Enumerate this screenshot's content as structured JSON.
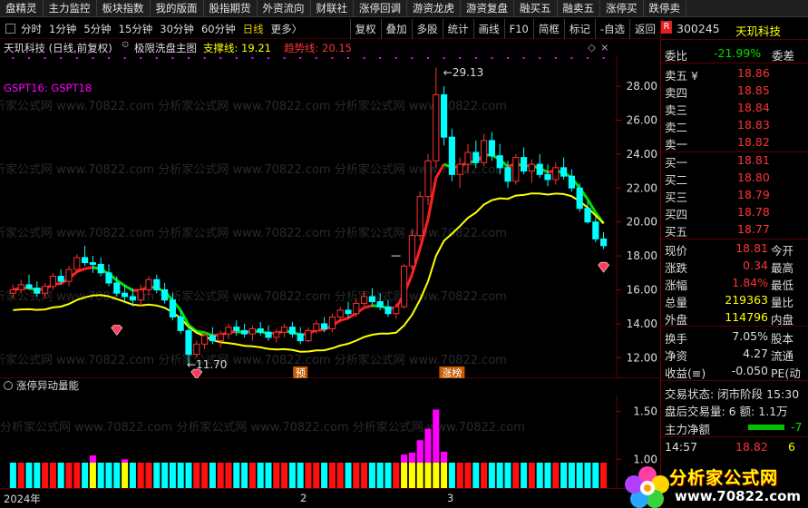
{
  "top_menu": [
    "盘精灵",
    "主力监控",
    "板块指数",
    "我的版面",
    "股指期货",
    "外资流向",
    "财联社",
    "涨停回调",
    "游资龙虎",
    "游资复盘",
    "融买五",
    "融卖五",
    "涨停买",
    "跌停卖"
  ],
  "toolbar": {
    "periods": [
      "分时",
      "1分钟",
      "5分钟",
      "15分钟",
      "30分钟",
      "60分钟",
      "日线",
      "更多〉"
    ],
    "active_period": "日线",
    "right_buttons": [
      "复权",
      "叠加",
      "多股",
      "统计",
      "画线",
      "F10",
      "简框",
      "标记",
      "-自选",
      "返回"
    ]
  },
  "chart_title": {
    "stock": "天玑科技 (日线,前复权)",
    "indicator": "极限洗盘主图",
    "support_label": "支撑线: 19.21",
    "trend_label": "趋势线: 20.15",
    "legend": "GSPT16: GSPT18"
  },
  "annotations": {
    "high": "29.13",
    "low": "11.70",
    "tag1": "预",
    "tag2": "涨榜"
  },
  "indicator_panel": {
    "title": "涨停异动量能",
    "axis": [
      "1.50",
      "1.00"
    ]
  },
  "time_axis": [
    "2024年",
    "2",
    "3"
  ],
  "watermark": "分析家公式网 www.70822.com",
  "colors": {
    "up": "#ff3232",
    "down": "#00ffff",
    "yellow": "#ffff00",
    "green": "#00e000",
    "magenta": "#ff00ff",
    "blue_bar": "#00ffff"
  },
  "chart_data": {
    "type": "candlestick",
    "y_ticks": [
      "28.00",
      "26.00",
      "24.00",
      "22.00",
      "20.00",
      "18.00",
      "16.00",
      "14.00",
      "12.00"
    ],
    "ylim": [
      11.0,
      29.5
    ],
    "candles": [
      [
        15.8,
        16.3,
        15.5,
        16.0
      ],
      [
        16.0,
        16.6,
        15.8,
        16.3
      ],
      [
        16.3,
        16.9,
        16.0,
        16.1
      ],
      [
        16.1,
        16.5,
        15.6,
        15.8
      ],
      [
        15.8,
        16.4,
        15.5,
        16.2
      ],
      [
        16.2,
        17.0,
        16.0,
        16.8
      ],
      [
        16.8,
        17.2,
        16.3,
        16.5
      ],
      [
        16.5,
        17.4,
        16.2,
        17.2
      ],
      [
        17.2,
        18.1,
        17.0,
        17.9
      ],
      [
        17.9,
        18.6,
        17.4,
        17.6
      ],
      [
        17.6,
        18.0,
        17.0,
        17.5
      ],
      [
        17.5,
        17.9,
        16.8,
        17.0
      ],
      [
        17.0,
        17.5,
        16.2,
        16.4
      ],
      [
        16.4,
        16.8,
        15.6,
        15.8
      ],
      [
        15.8,
        16.3,
        15.3,
        15.6
      ],
      [
        15.6,
        16.1,
        15.0,
        15.4
      ],
      [
        15.4,
        16.3,
        15.0,
        16.0
      ],
      [
        16.0,
        16.8,
        15.7,
        16.6
      ],
      [
        16.6,
        16.9,
        15.8,
        16.0
      ],
      [
        16.0,
        16.4,
        15.2,
        15.4
      ],
      [
        15.4,
        15.8,
        14.2,
        14.4
      ],
      [
        14.4,
        14.8,
        13.4,
        13.6
      ],
      [
        13.6,
        13.9,
        11.7,
        12.2
      ],
      [
        12.2,
        13.0,
        12.0,
        12.8
      ],
      [
        12.8,
        13.6,
        12.5,
        13.3
      ],
      [
        13.3,
        13.8,
        12.8,
        13.0
      ],
      [
        13.0,
        13.6,
        12.6,
        13.4
      ],
      [
        13.4,
        14.0,
        13.1,
        13.8
      ],
      [
        13.8,
        14.2,
        13.3,
        13.6
      ],
      [
        13.6,
        14.0,
        13.2,
        13.4
      ],
      [
        13.4,
        13.9,
        13.0,
        13.7
      ],
      [
        13.7,
        14.1,
        13.3,
        13.5
      ],
      [
        13.5,
        13.9,
        13.0,
        13.2
      ],
      [
        13.2,
        13.7,
        12.9,
        13.5
      ],
      [
        13.5,
        14.0,
        13.2,
        13.8
      ],
      [
        13.8,
        14.1,
        13.2,
        13.4
      ],
      [
        13.4,
        13.8,
        12.8,
        13.0
      ],
      [
        13.0,
        13.8,
        12.9,
        13.6
      ],
      [
        13.6,
        14.2,
        13.4,
        14.0
      ],
      [
        14.0,
        14.4,
        13.5,
        13.7
      ],
      [
        13.7,
        14.6,
        13.5,
        14.4
      ],
      [
        14.4,
        15.0,
        14.1,
        14.8
      ],
      [
        14.8,
        15.3,
        14.3,
        14.6
      ],
      [
        14.6,
        15.5,
        14.4,
        15.2
      ],
      [
        15.2,
        15.9,
        15.0,
        15.6
      ],
      [
        15.6,
        16.1,
        15.0,
        15.3
      ],
      [
        15.3,
        15.8,
        14.8,
        15.0
      ],
      [
        15.0,
        15.4,
        14.4,
        14.6
      ],
      [
        14.6,
        15.2,
        14.3,
        15.0
      ],
      [
        15.0,
        17.5,
        14.9,
        17.4
      ],
      [
        17.4,
        19.6,
        17.2,
        19.2
      ],
      [
        19.2,
        21.8,
        18.9,
        21.5
      ],
      [
        21.5,
        24.0,
        21.0,
        23.6
      ],
      [
        23.6,
        29.1,
        23.2,
        27.5
      ],
      [
        27.5,
        28.0,
        24.5,
        25.0
      ],
      [
        25.0,
        25.5,
        22.4,
        22.8
      ],
      [
        22.8,
        23.8,
        22.0,
        23.4
      ],
      [
        23.4,
        24.6,
        22.9,
        24.1
      ],
      [
        24.1,
        24.8,
        23.2,
        23.5
      ],
      [
        23.5,
        25.2,
        23.3,
        24.8
      ],
      [
        24.8,
        25.3,
        23.6,
        23.9
      ],
      [
        23.9,
        24.6,
        22.8,
        23.2
      ],
      [
        23.2,
        23.6,
        22.0,
        22.4
      ],
      [
        22.4,
        24.0,
        22.2,
        23.8
      ],
      [
        23.8,
        24.4,
        22.8,
        23.0
      ],
      [
        23.0,
        23.7,
        22.3,
        23.4
      ],
      [
        23.4,
        24.0,
        22.6,
        22.8
      ],
      [
        22.8,
        23.4,
        22.1,
        22.5
      ],
      [
        22.5,
        23.5,
        22.2,
        23.2
      ],
      [
        23.2,
        23.8,
        22.5,
        22.7
      ],
      [
        22.7,
        23.1,
        21.8,
        22.0
      ],
      [
        22.0,
        22.3,
        20.6,
        20.8
      ],
      [
        20.8,
        21.2,
        19.9,
        20.0
      ],
      [
        20.0,
        20.3,
        18.8,
        19.0
      ],
      [
        19.0,
        19.4,
        18.4,
        18.6
      ]
    ],
    "indicator_bars": [
      {
        "v": 0.7,
        "c": "cyan"
      },
      {
        "v": 0.7,
        "c": "red"
      },
      {
        "v": 0.7,
        "c": "cyan"
      },
      {
        "v": 0.7,
        "c": "cyan"
      },
      {
        "v": 0.7,
        "c": "red"
      },
      {
        "v": 0.7,
        "c": "red"
      },
      {
        "v": 0.7,
        "c": "cyan"
      },
      {
        "v": 0.7,
        "c": "red"
      },
      {
        "v": 0.7,
        "c": "red"
      },
      {
        "v": 0.7,
        "c": "cyan"
      },
      {
        "v": 1.04,
        "c": "magenta"
      },
      {
        "v": 0.7,
        "c": "cyan"
      },
      {
        "v": 0.7,
        "c": "cyan"
      },
      {
        "v": 0.7,
        "c": "cyan"
      },
      {
        "v": 1.0,
        "c": "magenta"
      },
      {
        "v": 0.7,
        "c": "cyan"
      },
      {
        "v": 0.7,
        "c": "red"
      },
      {
        "v": 0.7,
        "c": "red"
      },
      {
        "v": 0.7,
        "c": "cyan"
      },
      {
        "v": 0.7,
        "c": "cyan"
      },
      {
        "v": 0.7,
        "c": "cyan"
      },
      {
        "v": 0.7,
        "c": "cyan"
      },
      {
        "v": 0.7,
        "c": "cyan"
      },
      {
        "v": 0.7,
        "c": "red"
      },
      {
        "v": 0.7,
        "c": "red"
      },
      {
        "v": 0.7,
        "c": "cyan"
      },
      {
        "v": 0.7,
        "c": "red"
      },
      {
        "v": 0.7,
        "c": "red"
      },
      {
        "v": 0.7,
        "c": "cyan"
      },
      {
        "v": 0.7,
        "c": "cyan"
      },
      {
        "v": 0.7,
        "c": "red"
      },
      {
        "v": 0.7,
        "c": "cyan"
      },
      {
        "v": 0.7,
        "c": "cyan"
      },
      {
        "v": 0.7,
        "c": "red"
      },
      {
        "v": 0.7,
        "c": "red"
      },
      {
        "v": 0.7,
        "c": "cyan"
      },
      {
        "v": 0.7,
        "c": "cyan"
      },
      {
        "v": 0.7,
        "c": "red"
      },
      {
        "v": 0.7,
        "c": "red"
      },
      {
        "v": 0.7,
        "c": "cyan"
      },
      {
        "v": 0.7,
        "c": "red"
      },
      {
        "v": 0.7,
        "c": "red"
      },
      {
        "v": 0.7,
        "c": "cyan"
      },
      {
        "v": 0.7,
        "c": "red"
      },
      {
        "v": 0.7,
        "c": "red"
      },
      {
        "v": 0.7,
        "c": "cyan"
      },
      {
        "v": 0.7,
        "c": "cyan"
      },
      {
        "v": 0.7,
        "c": "cyan"
      },
      {
        "v": 0.7,
        "c": "red"
      },
      {
        "v": 1.05,
        "c": "magenta"
      },
      {
        "v": 1.07,
        "c": "magenta"
      },
      {
        "v": 1.2,
        "c": "magenta"
      },
      {
        "v": 1.32,
        "c": "magenta"
      },
      {
        "v": 1.52,
        "c": "magenta"
      },
      {
        "v": 1.08,
        "c": "magenta"
      },
      {
        "v": 0.7,
        "c": "cyan"
      },
      {
        "v": 0.7,
        "c": "red"
      },
      {
        "v": 0.7,
        "c": "red"
      },
      {
        "v": 0.7,
        "c": "cyan"
      },
      {
        "v": 0.7,
        "c": "red"
      },
      {
        "v": 0.7,
        "c": "cyan"
      },
      {
        "v": 0.7,
        "c": "cyan"
      },
      {
        "v": 0.7,
        "c": "cyan"
      },
      {
        "v": 0.7,
        "c": "red"
      },
      {
        "v": 0.7,
        "c": "cyan"
      },
      {
        "v": 0.7,
        "c": "red"
      },
      {
        "v": 0.7,
        "c": "cyan"
      },
      {
        "v": 0.7,
        "c": "cyan"
      },
      {
        "v": 0.7,
        "c": "red"
      },
      {
        "v": 0.7,
        "c": "cyan"
      },
      {
        "v": 0.7,
        "c": "cyan"
      },
      {
        "v": 0.7,
        "c": "cyan"
      },
      {
        "v": 0.7,
        "c": "cyan"
      },
      {
        "v": 0.7,
        "c": "cyan"
      },
      {
        "v": 0.7,
        "c": "red"
      }
    ],
    "indicator_ylim": [
      0.7,
      1.6
    ]
  },
  "quote": {
    "code": "300245",
    "name": "天玑科技",
    "weibi_label": "委比",
    "weibi": "-21.99%",
    "weicha_label": "委差",
    "asks": [
      {
        "label": "卖五 ¥",
        "price": "18.86"
      },
      {
        "label": "卖四",
        "price": "18.85"
      },
      {
        "label": "卖三",
        "price": "18.84"
      },
      {
        "label": "卖二",
        "price": "18.83"
      },
      {
        "label": "卖一",
        "price": "18.82"
      }
    ],
    "bids": [
      {
        "label": "买一",
        "price": "18.81"
      },
      {
        "label": "买二",
        "price": "18.80"
      },
      {
        "label": "买三",
        "price": "18.79"
      },
      {
        "label": "买四",
        "price": "18.78"
      },
      {
        "label": "买五",
        "price": "18.77"
      }
    ],
    "stats": [
      {
        "l1": "现价",
        "v1": "18.81",
        "l2": "今开"
      },
      {
        "l1": "涨跌",
        "v1": "0.34",
        "l2": "最高"
      },
      {
        "l1": "涨幅",
        "v1": "1.84%",
        "l2": "最低"
      },
      {
        "l1": "总量",
        "v1": "219363",
        "l2": "量比"
      },
      {
        "l1": "外盘",
        "v1": "114796",
        "l2": "内盘"
      }
    ],
    "stats2": [
      {
        "l1": "换手",
        "v1": "7.05%",
        "l2": "股本"
      },
      {
        "l1": "净资",
        "v1": "4.27",
        "l2": "流通"
      },
      {
        "l1": "收益(≡)",
        "v1": "-0.050",
        "l2": "PE(动"
      }
    ],
    "trade_state": "交易状态: 闭市阶段 15:30",
    "after_hours": "盘后交易量: 6  额: 1.1万",
    "main_net_label": "主力净额",
    "main_net_value": "-7",
    "tick_time": "14:57",
    "tick_price": "18.82",
    "tick_vol": "6"
  },
  "logo": {
    "text": "分析家公式网",
    "url": "www.70822.com"
  }
}
